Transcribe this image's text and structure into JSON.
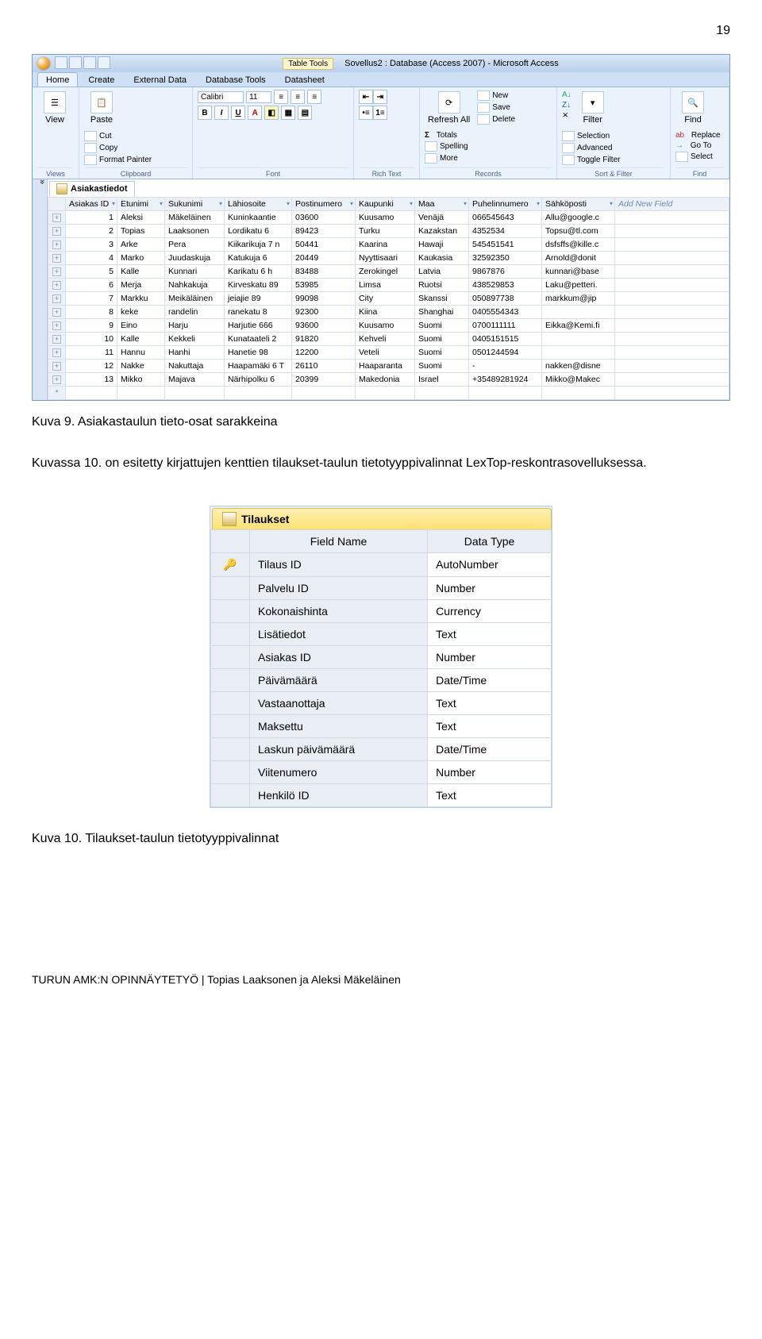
{
  "page_number": "19",
  "caption1": "Kuva 9. Asiakastaulun tieto-osat sarakkeina",
  "body_text": "Kuvassa 10. on esitetty kirjattujen kenttien tilaukset-taulun tietotyyppivalinnat LexTop-reskontrasovelluksessa.",
  "caption2": "Kuva 10. Tilaukset-taulun tietotyyppivalinnat",
  "footer_text": "TURUN AMK:N OPINNÄYTETYÖ | Topias Laaksonen ja Aleksi Mäkeläinen",
  "access": {
    "title_tool": "Table Tools",
    "title_main": "Sovellus2 : Database (Access 2007) - Microsoft Access",
    "tabs": [
      "Home",
      "Create",
      "External Data",
      "Database Tools",
      "Datasheet"
    ],
    "ribbon": {
      "views": "Views",
      "view": "View",
      "clipboard": "Clipboard",
      "paste": "Paste",
      "cut": "Cut",
      "copy": "Copy",
      "format_painter": "Format Painter",
      "font_group": "Font",
      "font_name": "Calibri",
      "font_size": "11",
      "richtext_group": "Rich Text",
      "records_group": "Records",
      "refresh": "Refresh All",
      "new": "New",
      "save": "Save",
      "delete": "Delete",
      "totals": "Totals",
      "spelling": "Spelling",
      "more": "More",
      "sortfilter_group": "Sort & Filter",
      "filter": "Filter",
      "selection": "Selection",
      "advanced": "Advanced",
      "toggle": "Toggle Filter",
      "find_group": "Find",
      "find": "Find",
      "replace": "Replace",
      "goto": "Go To",
      "select": "Select"
    },
    "doc_tab": "Asiakastiedot",
    "columns": [
      "Asiakas ID",
      "Etunimi",
      "Sukunimi",
      "Lähiosoite",
      "Postinumero",
      "Kaupunki",
      "Maa",
      "Puhelinnumero",
      "Sähköposti",
      "Add New Field"
    ],
    "rows": [
      [
        "1",
        "Aleksi",
        "Mäkeläinen",
        "Kuninkaantie",
        "03600",
        "Kuusamo",
        "Venäjä",
        "066545643",
        "Allu@google.c"
      ],
      [
        "2",
        "Topias",
        "Laaksonen",
        "Lordikatu 6",
        "89423",
        "Turku",
        "Kazakstan",
        "4352534",
        "Topsu@tl.com"
      ],
      [
        "3",
        "Arke",
        "Pera",
        "Kiikarikuja 7 n",
        "50441",
        "Kaarina",
        "Hawaji",
        "545451541",
        "dsfsffs@kille.c"
      ],
      [
        "4",
        "Marko",
        "Juudaskuja",
        "Katukuja 6",
        "20449",
        "Nyyttisaari",
        "Kaukasia",
        "32592350",
        "Arnold@donit"
      ],
      [
        "5",
        "Kalle",
        "Kunnari",
        "Karikatu 6 h",
        "83488",
        "Zerokingel",
        "Latvia",
        "9867876",
        "kunnari@base"
      ],
      [
        "6",
        "Merja",
        "Nahkakuja",
        "Kirveskatu 89",
        "53985",
        "Limsa",
        "Ruotsi",
        "438529853",
        "Laku@petteri."
      ],
      [
        "7",
        "Markku",
        "Meikäläinen",
        "jeiajie 89",
        "99098",
        "City",
        "Skanssi",
        "050897738",
        "markkum@jip"
      ],
      [
        "8",
        "keke",
        "randelin",
        "ranekatu 8",
        "92300",
        "Kiina",
        "Shanghai",
        "0405554343",
        ""
      ],
      [
        "9",
        "Eino",
        "Harju",
        "Harjutie 666",
        "93600",
        "Kuusamo",
        "Suomi",
        "0700111111",
        "Eikka@Kemi.fi"
      ],
      [
        "10",
        "Kalle",
        "Kekkeli",
        "Kunataateli 2",
        "91820",
        "Kehveli",
        "Suomi",
        "0405151515",
        ""
      ],
      [
        "11",
        "Hannu",
        "Hanhi",
        "Hanetie 98",
        "12200",
        "Veteli",
        "Suomi",
        "0501244594",
        ""
      ],
      [
        "12",
        "Nakke",
        "Nakuttaja",
        "Haapamäki 6 T",
        "26110",
        "Haaparanta",
        "Suomi",
        "-",
        "nakken@disne"
      ],
      [
        "13",
        "Mikko",
        "Majava",
        "Närhipolku 6",
        "20399",
        "Makedonia",
        "Israel",
        "+35489281924",
        "Mikko@Makec"
      ]
    ]
  },
  "design": {
    "tab_label": "Tilaukset",
    "col1": "Field Name",
    "col2": "Data Type",
    "fields": [
      [
        "Tilaus ID",
        "AutoNumber",
        true
      ],
      [
        "Palvelu ID",
        "Number",
        false
      ],
      [
        "Kokonaishinta",
        "Currency",
        false
      ],
      [
        "Lisätiedot",
        "Text",
        false
      ],
      [
        "Asiakas ID",
        "Number",
        false
      ],
      [
        "Päivämäärä",
        "Date/Time",
        false
      ],
      [
        "Vastaanottaja",
        "Text",
        false
      ],
      [
        "Maksettu",
        "Text",
        false
      ],
      [
        "Laskun päivämäärä",
        "Date/Time",
        false
      ],
      [
        "Viitenumero",
        "Number",
        false
      ],
      [
        "Henkilö ID",
        "Text",
        false
      ]
    ]
  }
}
